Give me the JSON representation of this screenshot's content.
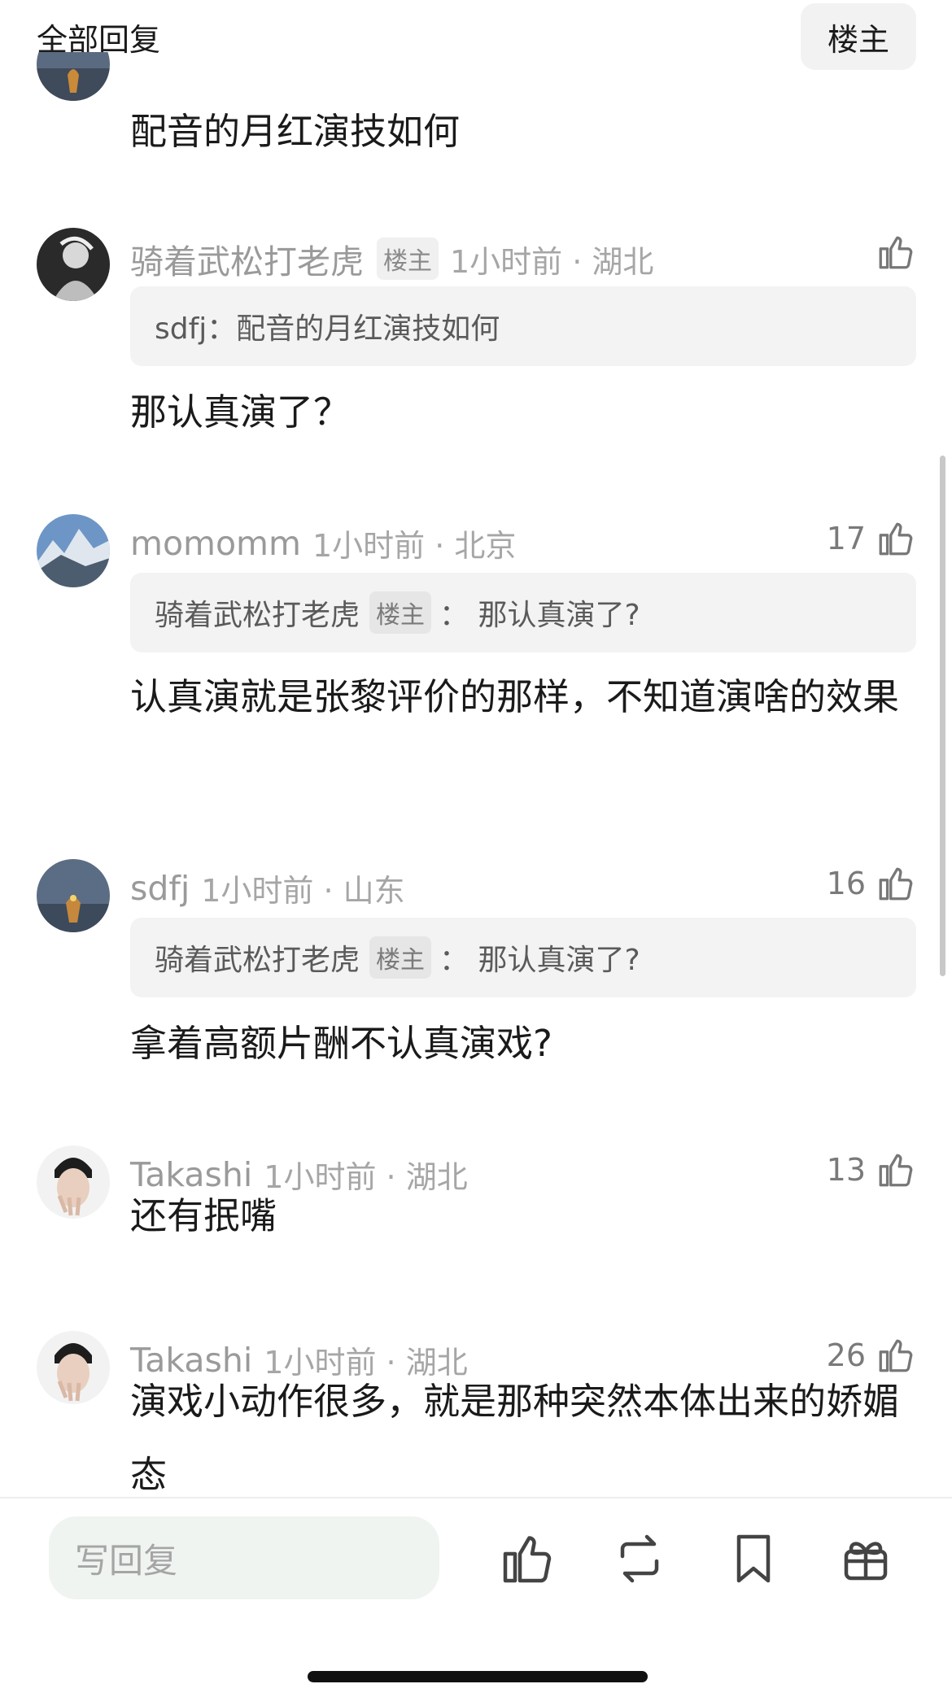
{
  "header": {
    "title": "全部回复",
    "owner_button": "楼主"
  },
  "top_partial": {
    "text": "配音的月红演技如何"
  },
  "comments": [
    {
      "username": "骑着武松打老虎",
      "owner_tag": "楼主",
      "time_location": "1小时前 · 湖北",
      "like_count": "",
      "quote_prefix": "sdfj：",
      "quote_text": "配音的月红演技如何",
      "text": "那认真演了？"
    },
    {
      "username": "momomm",
      "time_location": "1小时前 · 北京",
      "like_count": "17",
      "quote_user": "骑着武松打老虎",
      "quote_tag": "楼主",
      "quote_text": "：  那认真演了?",
      "text": "认真演就是张黎评价的那样，不知道演啥的效果"
    },
    {
      "username": "sdfj",
      "time_location": "1小时前 · 山东",
      "like_count": "16",
      "quote_user": "骑着武松打老虎",
      "quote_tag": "楼主",
      "quote_text": "：  那认真演了?",
      "text": "拿着高额片酬不认真演戏?"
    },
    {
      "username": "Takashi",
      "time_location": "1小时前 · 湖北",
      "like_count": "13",
      "text": "还有抿嘴"
    },
    {
      "username": "Takashi",
      "time_location": "1小时前 · 湖北",
      "like_count": "26",
      "text": "演戏小动作很多，就是那种突然本体出来的娇媚态"
    }
  ],
  "bottom_bar": {
    "reply_placeholder": "写回复"
  },
  "icons": [
    "thumb-up-icon",
    "repost-icon",
    "bookmark-icon",
    "gift-icon"
  ],
  "colors": {
    "meta_gray": "#9a9a9a",
    "quote_bg": "#f3f3f3",
    "input_bg": "#f0f4f1"
  }
}
